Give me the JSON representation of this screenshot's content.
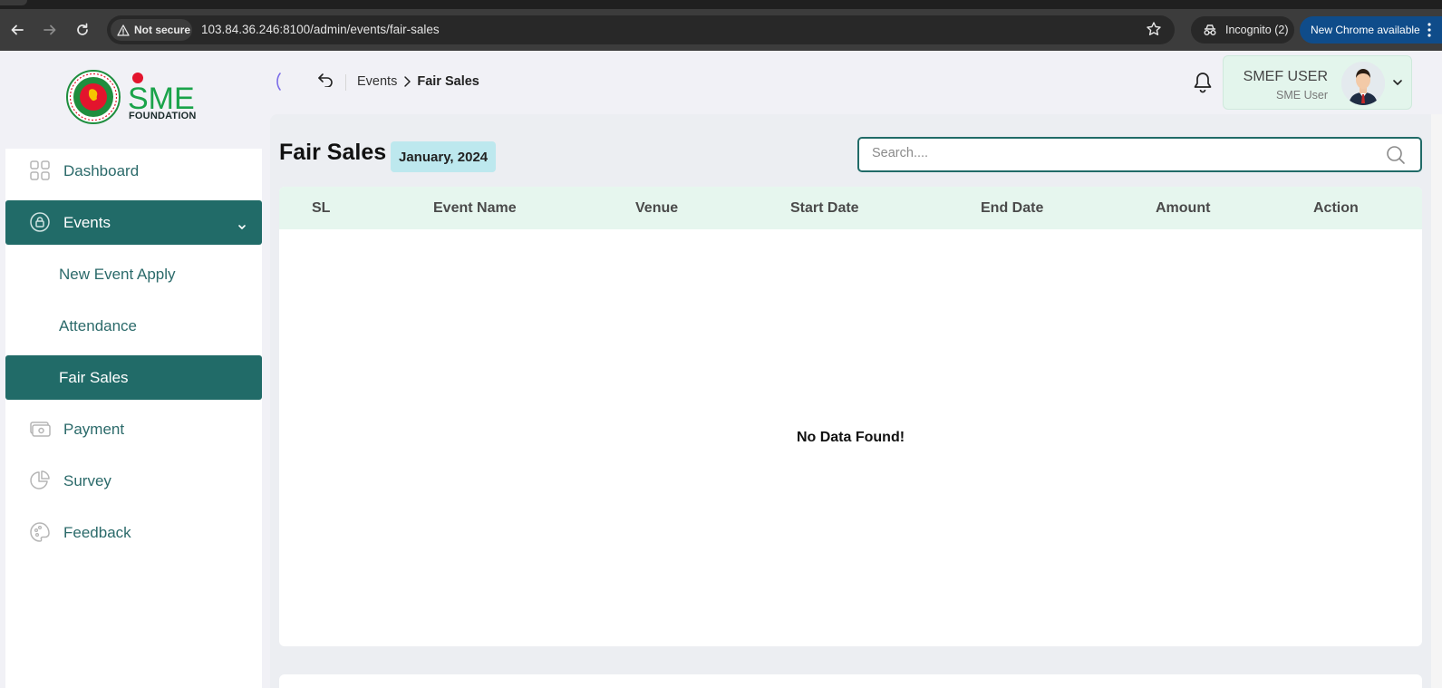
{
  "browser": {
    "security_label": "Not secure",
    "url": "103.84.36.246:8100/admin/events/fair-sales",
    "incognito_label": "Incognito (2)",
    "update_label": "New Chrome available"
  },
  "brand": {
    "logo_text": "SME",
    "logo_subtext": "FOUNDATION"
  },
  "sidebar": {
    "items": [
      {
        "label": "Dashboard",
        "icon": "grid-icon"
      },
      {
        "label": "Events",
        "icon": "lock-circle-icon"
      },
      {
        "label": "Payment",
        "icon": "money-icon"
      },
      {
        "label": "Survey",
        "icon": "pie-chart-icon"
      },
      {
        "label": "Feedback",
        "icon": "palette-icon"
      }
    ],
    "events_sub": [
      {
        "label": "New Event Apply"
      },
      {
        "label": "Attendance"
      },
      {
        "label": "Fair Sales"
      }
    ]
  },
  "breadcrumb": {
    "parent": "Events",
    "current": "Fair Sales"
  },
  "user": {
    "name": "SMEF USER",
    "role": "SME User"
  },
  "page": {
    "title": "Fair Sales",
    "period": "January, 2024"
  },
  "search": {
    "placeholder": "Search...."
  },
  "table": {
    "columns": [
      "SL",
      "Event Name",
      "Venue",
      "Start Date",
      "End Date",
      "Amount",
      "Action"
    ],
    "rows": [],
    "empty_message": "No Data Found!"
  },
  "colors": {
    "primary": "#216b68",
    "header_bg": "#e6f6ee",
    "badge_bg": "#bde8ee"
  }
}
